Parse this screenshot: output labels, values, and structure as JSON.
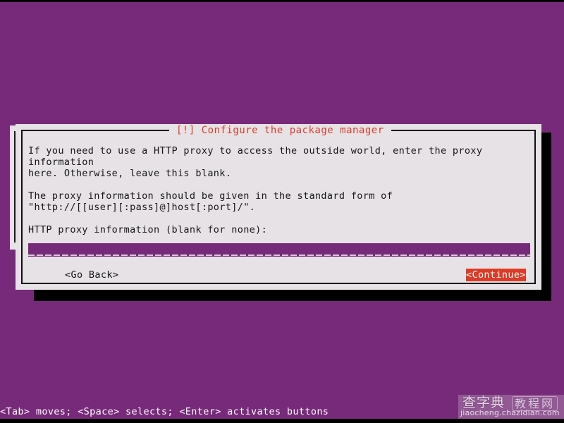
{
  "screen": {
    "background_color": "#772a79",
    "foreground_color": "#ffffff"
  },
  "dialog": {
    "title": "[!] Configure the package manager",
    "title_color": "#dd3b26",
    "surface_color": "#e6e2e6",
    "text_color": "#161616",
    "paragraphs": [
      "If you need to use a HTTP proxy to access the outside world, enter the proxy information\nhere. Otherwise, leave this blank.",
      "The proxy information should be given in the standard form of\n\"http://[[user][:pass]@]host[:port]/\"."
    ],
    "field": {
      "label": "HTTP proxy information (blank for none):",
      "value": "",
      "placeholder": "",
      "field_background": "#772a79",
      "field_text_color": "#ffffff"
    },
    "buttons": [
      {
        "name": "go-back",
        "label": "<Go Back>",
        "selected": false
      },
      {
        "name": "continue",
        "label": "<Continue>",
        "selected": true,
        "selected_background": "#dd3b26",
        "selected_text_color": "#ffffff"
      }
    ]
  },
  "help_bar": {
    "text": "<Tab> moves; <Space> selects; <Enter> activates buttons"
  },
  "watermark": {
    "brand_cn": "查字典",
    "brand_cn_secondary": "教程网",
    "url": "jiaocheng.chazidian.com"
  }
}
